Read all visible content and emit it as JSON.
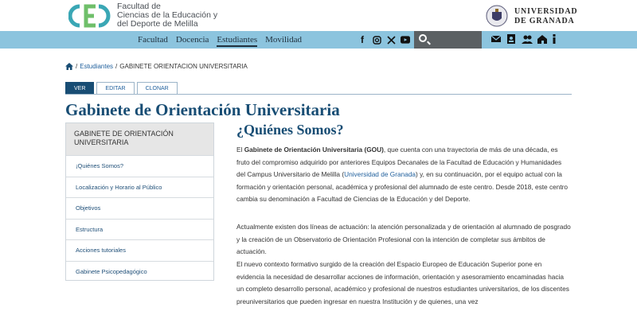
{
  "header": {
    "faculty_line1": "Facultad de",
    "faculty_line2": "Ciencias de la Educación y",
    "faculty_line3": "del Deporte de Melilla",
    "university_line1": "UNIVERSIDAD",
    "university_line2": "DE GRANADA"
  },
  "nav": {
    "items": [
      "Facultad",
      "Docencia",
      "Estudiantes",
      "Movilidad"
    ],
    "active": "Estudiantes"
  },
  "social": [
    "f",
    "ig",
    "X",
    "yt"
  ],
  "breadcrumb": {
    "link": "Estudiantes",
    "separator": "/",
    "current": "GABINETE ORIENTACION UNIVERSITARIA"
  },
  "tabs": [
    "VER",
    "EDITAR",
    "CLONAR"
  ],
  "page_title": "Gabinete de Orientación Universitaria",
  "sidebar": {
    "heading": "GABINETE DE ORIENTACIÓN UNIVERSITARIA",
    "items": [
      "¡Quiénes Somos?",
      "Localización y Horario al Público",
      "Objetivos",
      "Estructura",
      "Acciones tutoriales",
      "Gabinete Psicopedagógico"
    ]
  },
  "content": {
    "title": "¿Quiénes Somos?",
    "p1_prefix": "El ",
    "p1_bold": "Gabinete de Orientación Universitaria (GOU)",
    "p1_mid": ", que cuenta con una trayectoria de más de una década, es fruto del compromiso adquirido por anteriores Equipos Decanales de la Facultad de Educación y Humanidades del Campus Universitario de Melilla (",
    "p1_link": "Universidad de Granada",
    "p1_suffix": ") y, en su continuación, por el equipo actual con la formación y orientación personal, académica y profesional del alumnado de este centro. Desde 2018, este centro cambia su denominación a Facultad de Ciencias de la Educación y del Deporte.",
    "p2": "Actualmente existen dos líneas de actuación: la atención personalizada y de orientación al alumnado de posgrado y la creación de un Observatorio de Orientación Profesional con la intención de completar sus ámbitos de actuación.",
    "p3": "El nuevo contexto formativo surgido de la creación del Espacio Europeo de Educación Superior pone en evidencia la necesidad de desarrollar acciones de información, orientación y asesoramiento encaminadas hacia un completo desarrollo personal, académico y profesional de nuestros estudiantes universitarios, de los discentes preuniversitarios que pueden ingresar en nuestra Institución y de quienes, una vez"
  },
  "colors": {
    "navbar": "#8cc4de",
    "title": "#184d74",
    "link": "#1f5f9c",
    "tab_active": "#184d74",
    "logo_teal": "#3aa7b5",
    "logo_green": "#6fbf6a"
  }
}
